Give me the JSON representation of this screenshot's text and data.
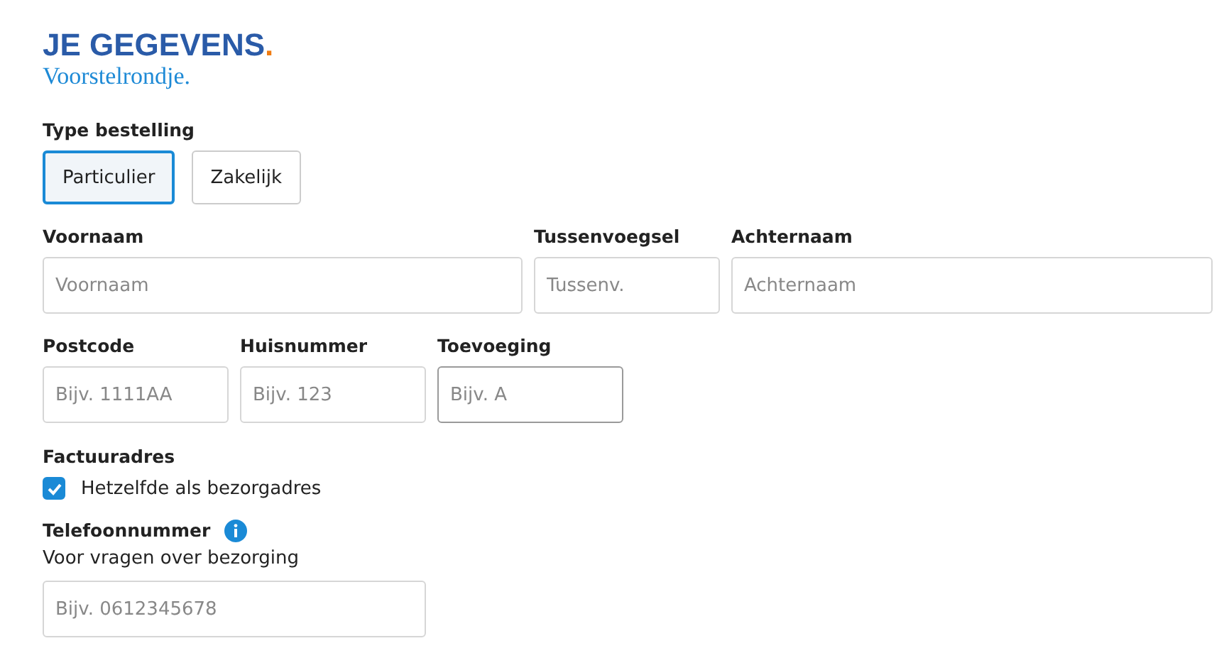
{
  "header": {
    "title": "JE GEGEVENS",
    "title_mark": ".",
    "subtitle": "Voorstelrondje."
  },
  "order_type": {
    "label": "Type bestelling",
    "options": [
      {
        "label": "Particulier",
        "selected": true
      },
      {
        "label": "Zakelijk",
        "selected": false
      }
    ]
  },
  "field_rows": [
    {
      "fields": [
        {
          "label": "Voornaam",
          "placeholder": "Voornaam",
          "focused": false
        },
        {
          "label": "Tussenvoegsel",
          "placeholder": "Tussenv.",
          "focused": false
        },
        {
          "label": "Achternaam",
          "placeholder": "Achternaam",
          "focused": false
        }
      ]
    },
    {
      "fields": [
        {
          "label": "Postcode",
          "placeholder": "Bijv. 1111AA",
          "focused": false
        },
        {
          "label": "Huisnummer",
          "placeholder": "Bijv. 123",
          "focused": false
        },
        {
          "label": "Toevoeging",
          "placeholder": "Bijv. A",
          "focused": true
        }
      ]
    }
  ],
  "billing": {
    "label": "Factuuradres",
    "checkbox": {
      "label": "Hetzelfde als bezorgadres",
      "checked": true
    }
  },
  "phone": {
    "label": "Telefoonnummer",
    "hint": "Voor vragen over bezorging",
    "placeholder": "Bijv. 0612345678"
  }
}
